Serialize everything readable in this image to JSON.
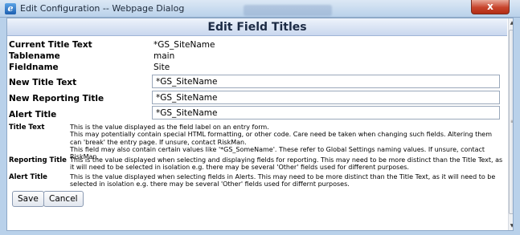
{
  "window": {
    "title": "Edit Configuration -- Webpage Dialog",
    "close_glyph": "x",
    "app_icon_glyph": "e"
  },
  "heading": "Edit Field Titles",
  "info": [
    {
      "label": "Current Title Text",
      "value": "*GS_SiteName"
    },
    {
      "label": "Tablename",
      "value": "main"
    },
    {
      "label": "Fieldname",
      "value": "Site"
    }
  ],
  "fields": [
    {
      "label": "New Title Text",
      "value": "*GS_SiteName"
    },
    {
      "label": "New Reporting Title",
      "value": "*GS_SiteName"
    },
    {
      "label": "Alert Title",
      "value": "*GS_SiteName"
    }
  ],
  "help": [
    {
      "title": "Title Text",
      "lines": [
        "This is the value displayed as the field label on an entry form.",
        "This may potentially contain special HTML formatting, or other code. Care need be taken when changing such fields. Altering them can 'break' the entry page. If unsure, contact RiskMan.",
        "This field may also contain certain values like '*GS_SomeName'. These refer to Global Settings naming values. If unsure, contact RiskMan."
      ]
    },
    {
      "title": "Reporting Title",
      "lines": [
        "This is the value displayed when selecting and displaying fields for reporting. This may need to be more distinct than the Title Text, as it will need to be selected in isolation e.g. there may be several 'Other' fields used for different purposes."
      ]
    },
    {
      "title": "Alert Title",
      "lines": [
        "This is the value displayed when selecting fields in Alerts. This may need to be more distinct than the Title Text, as it will need to be selected in isolation e.g. there may be several 'Other' fields used for differnt purposes."
      ]
    }
  ],
  "buttons": {
    "save": "Save",
    "cancel": "Cancel"
  },
  "scrollbar": {
    "up": "▲",
    "down": "▼",
    "grip": "≡"
  }
}
